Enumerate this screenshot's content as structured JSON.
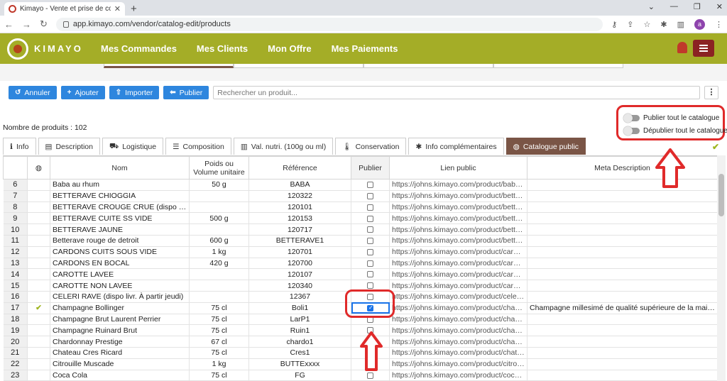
{
  "browser": {
    "tab_title": "Kimayo - Vente et prise de comm",
    "url": "app.kimayo.com/vendor/catalog-edit/products",
    "avatar_letter": "a"
  },
  "app": {
    "brand": "KIMAYO",
    "nav": [
      "Mes Commandes",
      "Mes Clients",
      "Mon Offre",
      "Mes Paiements"
    ],
    "colors": {
      "header": "#a4ad27",
      "button": "#2e86de",
      "active_tab": "#7a5546",
      "annotation": "#e02a2a"
    }
  },
  "toolbar": {
    "cancel": "Annuler",
    "add": "Ajouter",
    "import": "Importer",
    "publish": "Publier",
    "search_placeholder": "Rechercher un produit..."
  },
  "count_label": "Nombre de produits : 102",
  "toggles": {
    "publish_all": "Publier tout le catalogue",
    "unpublish_all": "Dépublier tout le catalogue"
  },
  "tabs": [
    "Info",
    "Description",
    "Logistique",
    "Composition",
    "Val. nutri. (100g ou ml)",
    "Conservation",
    "Info complémentaires",
    "Catalogue public"
  ],
  "table": {
    "headers": {
      "nom": "Nom",
      "poids_line1": "Poids ou",
      "poids_line2": "Volume unitaire",
      "ref": "Référence",
      "publier": "Publier",
      "lien": "Lien public",
      "meta": "Meta Description"
    },
    "rows": [
      {
        "n": "6",
        "ok": "",
        "nom": "Baba au rhum",
        "poids": "50 g",
        "ref": "BABA",
        "pub": false,
        "lien": "https://johns.kimayo.com/product/baba-a...",
        "meta": ""
      },
      {
        "n": "7",
        "ok": "",
        "nom": "BETTERAVE CHIOGGIA",
        "poids": "",
        "ref": "120322",
        "pub": false,
        "lien": "https://johns.kimayo.com/product/bettera...",
        "meta": ""
      },
      {
        "n": "8",
        "ok": "",
        "nom": "BETTERAVE CROUGE CRUE (dispo livr. À ...",
        "poids": "",
        "ref": "120101",
        "pub": false,
        "lien": "https://johns.kimayo.com/product/bettera...",
        "meta": ""
      },
      {
        "n": "9",
        "ok": "",
        "nom": "BETTERAVE CUITE SS VIDE",
        "poids": "500 g",
        "ref": "120153",
        "pub": false,
        "lien": "https://johns.kimayo.com/product/bettera...",
        "meta": ""
      },
      {
        "n": "10",
        "ok": "",
        "nom": "BETTERAVE JAUNE",
        "poids": "",
        "ref": "120717",
        "pub": false,
        "lien": "https://johns.kimayo.com/product/bettera...",
        "meta": ""
      },
      {
        "n": "11",
        "ok": "",
        "nom": "Betterave rouge de detroit",
        "poids": "600 g",
        "ref": "BETTERAVE1",
        "pub": false,
        "lien": "https://johns.kimayo.com/product/bettera...",
        "meta": ""
      },
      {
        "n": "12",
        "ok": "",
        "nom": "CARDONS CUITS SOUS VIDE",
        "poids": "1 kg",
        "ref": "120701",
        "pub": false,
        "lien": "https://johns.kimayo.com/product/cardon...",
        "meta": ""
      },
      {
        "n": "13",
        "ok": "",
        "nom": "CARDONS EN BOCAL",
        "poids": "420 g",
        "ref": "120700",
        "pub": false,
        "lien": "https://johns.kimayo.com/product/cardon...",
        "meta": ""
      },
      {
        "n": "14",
        "ok": "",
        "nom": "CAROTTE LAVEE",
        "poids": "",
        "ref": "120107",
        "pub": false,
        "lien": "https://johns.kimayo.com/product/carotte...",
        "meta": ""
      },
      {
        "n": "15",
        "ok": "",
        "nom": "CAROTTE NON LAVEE",
        "poids": "",
        "ref": "120340",
        "pub": false,
        "lien": "https://johns.kimayo.com/product/carotte...",
        "meta": ""
      },
      {
        "n": "16",
        "ok": "",
        "nom": "CELERI RAVE (dispo livr. À partir jeudi)",
        "poids": "",
        "ref": "12367",
        "pub": false,
        "lien": "https://johns.kimayo.com/product/celeri-r...",
        "meta": ""
      },
      {
        "n": "17",
        "ok": "✔",
        "nom": "Champagne Bollinger",
        "poids": "75 cl",
        "ref": "Boli1",
        "pub": true,
        "lien": "https://johns.kimayo.com/product/champ...",
        "meta": "Champagne millesimé de qualité supérieure de la maison B..."
      },
      {
        "n": "18",
        "ok": "",
        "nom": "Champagne Brut Laurent Perrier",
        "poids": "75 cl",
        "ref": "LarP1",
        "pub": false,
        "lien": "https://johns.kimayo.com/product/champ...",
        "meta": ""
      },
      {
        "n": "19",
        "ok": "",
        "nom": "Champagne Ruinard Brut",
        "poids": "75 cl",
        "ref": "Ruin1",
        "pub": false,
        "lien": "https://johns.kimayo.com/product/champ...",
        "meta": ""
      },
      {
        "n": "20",
        "ok": "",
        "nom": "Chardonnay Prestige",
        "poids": "67 cl",
        "ref": "chardo1",
        "pub": false,
        "lien": "https://johns.kimayo.com/product/chardo...",
        "meta": ""
      },
      {
        "n": "21",
        "ok": "",
        "nom": "Chateau Cres Ricard",
        "poids": "75 cl",
        "ref": "Cres1",
        "pub": false,
        "lien": "https://johns.kimayo.com/product/chatea...",
        "meta": ""
      },
      {
        "n": "22",
        "ok": "",
        "nom": "Citrouille Muscade",
        "poids": "1 kg",
        "ref": "BUTTExxxx",
        "pub": false,
        "lien": "https://johns.kimayo.com/product/citrouill...",
        "meta": ""
      },
      {
        "n": "23",
        "ok": "",
        "nom": "Coca Cola",
        "poids": "75 cl",
        "ref": "FG",
        "pub": false,
        "lien": "https://johns.kimayo.com/product/coca-c...",
        "meta": ""
      }
    ]
  }
}
